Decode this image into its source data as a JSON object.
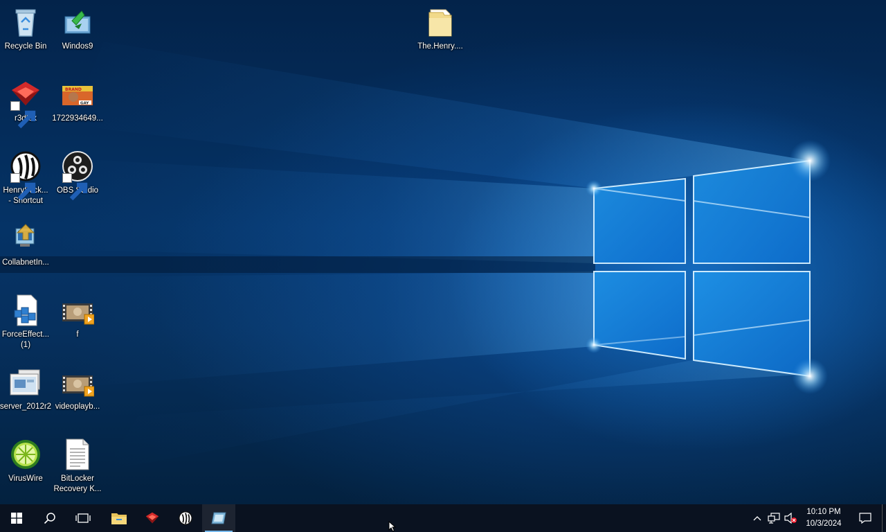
{
  "desktop": {
    "icons": [
      {
        "id": "recycle-bin",
        "label": "Recycle Bin",
        "icon": "recycle-bin-icon"
      },
      {
        "id": "windos9",
        "label": "Windos9",
        "icon": "installer-icon"
      },
      {
        "id": "the-henry",
        "label": "The.Henry....",
        "icon": "folder-icon"
      },
      {
        "id": "r3dfox",
        "label": "r3dfox",
        "icon": "r3dfox-icon",
        "shortcut": true
      },
      {
        "id": "image-1722934649",
        "label": "1722934649...",
        "icon": "image-thumbnail-icon"
      },
      {
        "id": "henrystick",
        "label": "HenryStick...\n- Shortcut",
        "icon": "henrystick-icon",
        "shortcut": true
      },
      {
        "id": "obs-studio",
        "label": "OBS Studio",
        "icon": "obs-icon",
        "shortcut": true
      },
      {
        "id": "collabnet",
        "label": "CollabnetIn...",
        "icon": "setup-icon"
      },
      {
        "id": "forceeffect",
        "label": "ForceEffect...\n(1)",
        "icon": "registry-icon"
      },
      {
        "id": "f-video",
        "label": "f",
        "icon": "video-file-icon"
      },
      {
        "id": "server-2012r2",
        "label": "server_2012r2",
        "icon": "screenshot-icon"
      },
      {
        "id": "videoplayback",
        "label": "videoplayb...",
        "icon": "video-file-icon"
      },
      {
        "id": "viruswire",
        "label": "VirusWire",
        "icon": "limewire-icon"
      },
      {
        "id": "bitlocker",
        "label": "BitLocker\nRecovery K...",
        "icon": "text-document-icon"
      }
    ],
    "thumbnail_text": [
      "BRAND",
      "GAY"
    ]
  },
  "taskbar": {
    "start": "start-icon",
    "search": "search-icon",
    "task_view": "task-view-icon",
    "pinned": [
      {
        "name": "file-explorer",
        "icon": "folder-icon"
      },
      {
        "name": "r3dfox",
        "icon": "r3dfox-icon"
      },
      {
        "name": "henrystick",
        "icon": "henrystick-icon"
      },
      {
        "name": "app-active",
        "icon": "app-window-icon",
        "active": true
      }
    ],
    "tray": {
      "time": "10:10 PM",
      "date": "10/3/2024"
    }
  },
  "colors": {
    "taskbar": "#0a1220",
    "active_indicator": "#76b9ed",
    "wallpaper_light": "#3fa9f5"
  }
}
